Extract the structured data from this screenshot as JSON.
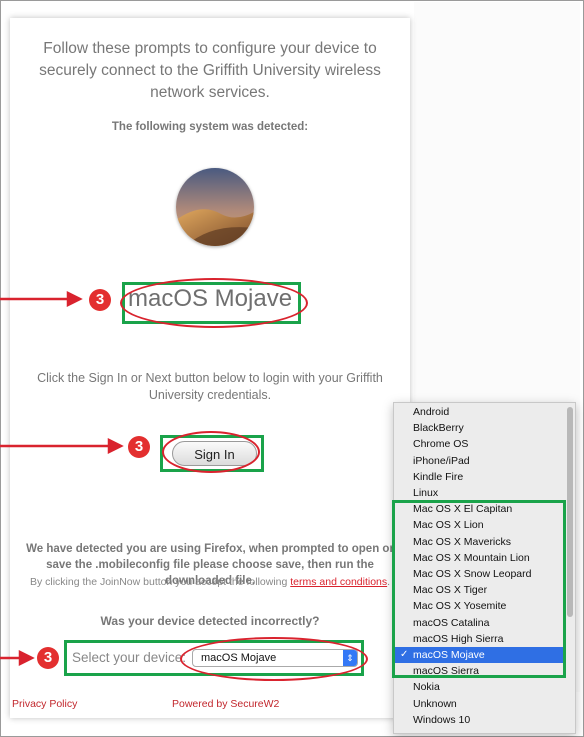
{
  "intro_text": "Follow these prompts to configure your device to securely connect to the Griffith University wireless network services.",
  "detected_label": "The following system was detected:",
  "detected_os": "macOS Mojave",
  "sign_in_prompt": "Click the Sign In or Next button below to login with your Griffith University credentials.",
  "sign_in_button": "Sign In",
  "firefox_notice": "We have detected you are using Firefox, when prompted to open or save the .mobileconfig file please choose save, then run the downloaded file.",
  "terms": {
    "prefix": "By clicking the JoinNow button you accept the following ",
    "link": "terms and conditions",
    "suffix": "."
  },
  "wrong_detect": "Was your device detected incorrectly?",
  "select_label": "Select your device:",
  "select_value": "macOS Mojave",
  "footer": {
    "privacy": "Privacy Policy",
    "powered": "Powered by SecureW2"
  },
  "step_badge": "3",
  "dropdown_options": [
    "Android",
    "BlackBerry",
    "Chrome OS",
    "iPhone/iPad",
    "Kindle Fire",
    "Linux",
    "Mac OS X El Capitan",
    "Mac OS X Lion",
    "Mac OS X Mavericks",
    "Mac OS X Mountain Lion",
    "Mac OS X Snow Leopard",
    "Mac OS X Tiger",
    "Mac OS X Yosemite",
    "macOS Catalina",
    "macOS High Sierra",
    "macOS Mojave",
    "macOS Sierra",
    "Nokia",
    "Unknown",
    "Windows 10"
  ],
  "selected_option": "macOS Mojave",
  "colors": {
    "annotation_red": "#d9232e",
    "highlight_green": "#1aa34a",
    "select_blue": "#2f6fe4"
  }
}
